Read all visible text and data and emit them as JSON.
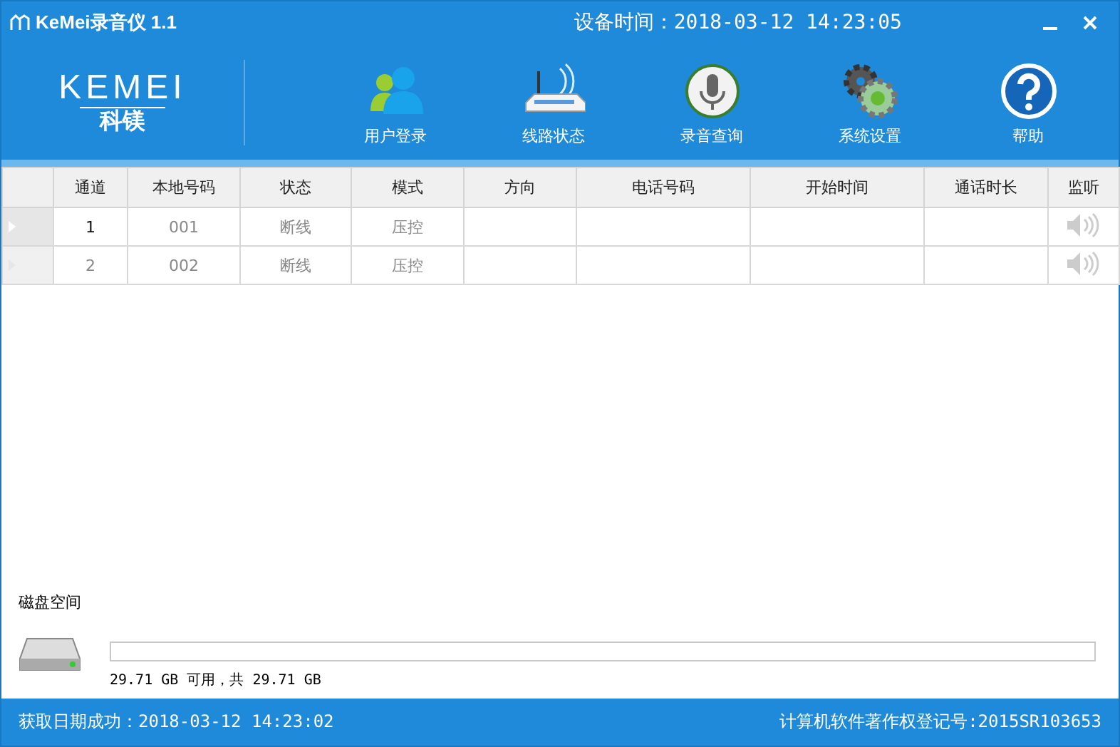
{
  "window": {
    "title": "KeMei录音仪 1.1",
    "device_time": "设备时间：2018-03-12 14:23:05"
  },
  "logo": {
    "wordmark": "KEMEI",
    "subtitle": "科镁"
  },
  "toolbar": [
    {
      "label": "用户登录",
      "kind": "users"
    },
    {
      "label": "线路状态",
      "kind": "router"
    },
    {
      "label": "录音查询",
      "kind": "mic"
    },
    {
      "label": "系统设置",
      "kind": "gears"
    },
    {
      "label": "帮助",
      "kind": "help"
    }
  ],
  "table": {
    "columns": [
      "通道",
      "本地号码",
      "状态",
      "模式",
      "方向",
      "电话号码",
      "开始时间",
      "通话时长",
      "监听"
    ],
    "rows": [
      {
        "selected": true,
        "cells": [
          "1",
          "001",
          "断线",
          "压控",
          "",
          "",
          "",
          ""
        ]
      },
      {
        "selected": false,
        "cells": [
          "2",
          "002",
          "断线",
          "压控",
          "",
          "",
          "",
          ""
        ]
      }
    ]
  },
  "disk": {
    "label": "磁盘空间",
    "reading": "29.71 GB 可用，共 29.71 GB"
  },
  "status_bar": {
    "left": "获取日期成功：2018-03-12 14:23:02",
    "right": "计算机软件著作权登记号:2015SR103653"
  }
}
